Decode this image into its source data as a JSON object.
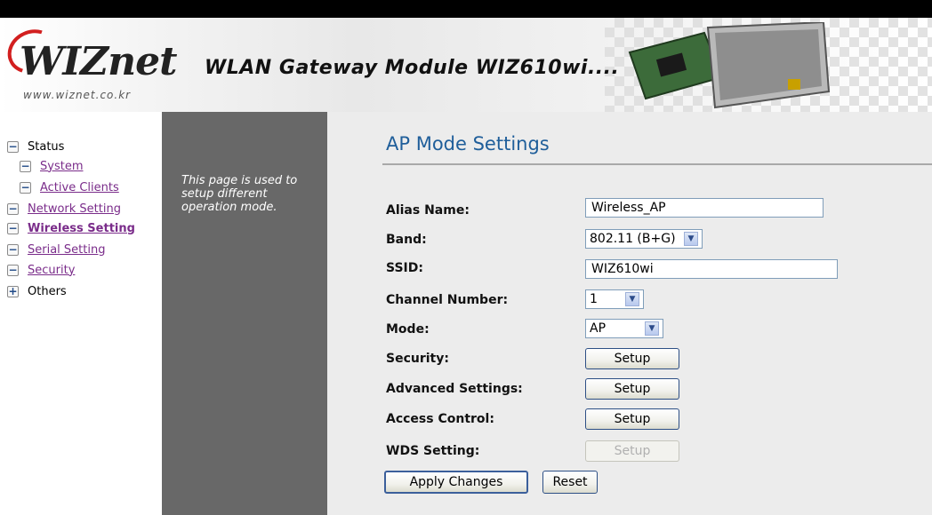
{
  "header": {
    "logo_text": "WIZnet",
    "logo_url": "www.wiznet.co.kr",
    "title": "WLAN Gateway Module WIZ610wi....",
    "brand_color": "#d21f1f"
  },
  "sidebar": {
    "items": [
      {
        "label": "Status",
        "toggle": "−",
        "link": false
      },
      {
        "label": "System",
        "toggle": "−",
        "link": true
      },
      {
        "label": "Active Clients",
        "toggle": "−",
        "link": true
      },
      {
        "label": "Network Setting",
        "toggle": "−",
        "link": true
      },
      {
        "label": "Wireless Setting",
        "toggle": "−",
        "link": true,
        "active": true
      },
      {
        "label": "Serial Setting",
        "toggle": "−",
        "link": true
      },
      {
        "label": "Security",
        "toggle": "−",
        "link": true
      },
      {
        "label": "Others",
        "toggle": "+",
        "link": false
      }
    ]
  },
  "description": "This page is used to setup different operation mode.",
  "main": {
    "title": "AP Mode Settings",
    "fields": {
      "alias_label": "Alias Name:",
      "alias_value": "Wireless_AP",
      "band_label": "Band:",
      "band_value": "802.11 (B+G)",
      "ssid_label": "SSID:",
      "ssid_value": "WIZ610wi",
      "channel_label": "Channel Number:",
      "channel_value": "1",
      "mode_label": "Mode:",
      "mode_value": "AP",
      "security_label": "Security:",
      "advanced_label": "Advanced Settings:",
      "access_label": "Access Control:",
      "wds_label": "WDS Setting:",
      "setup_label": "Setup"
    },
    "apply_label": "Apply Changes",
    "reset_label": "Reset"
  }
}
